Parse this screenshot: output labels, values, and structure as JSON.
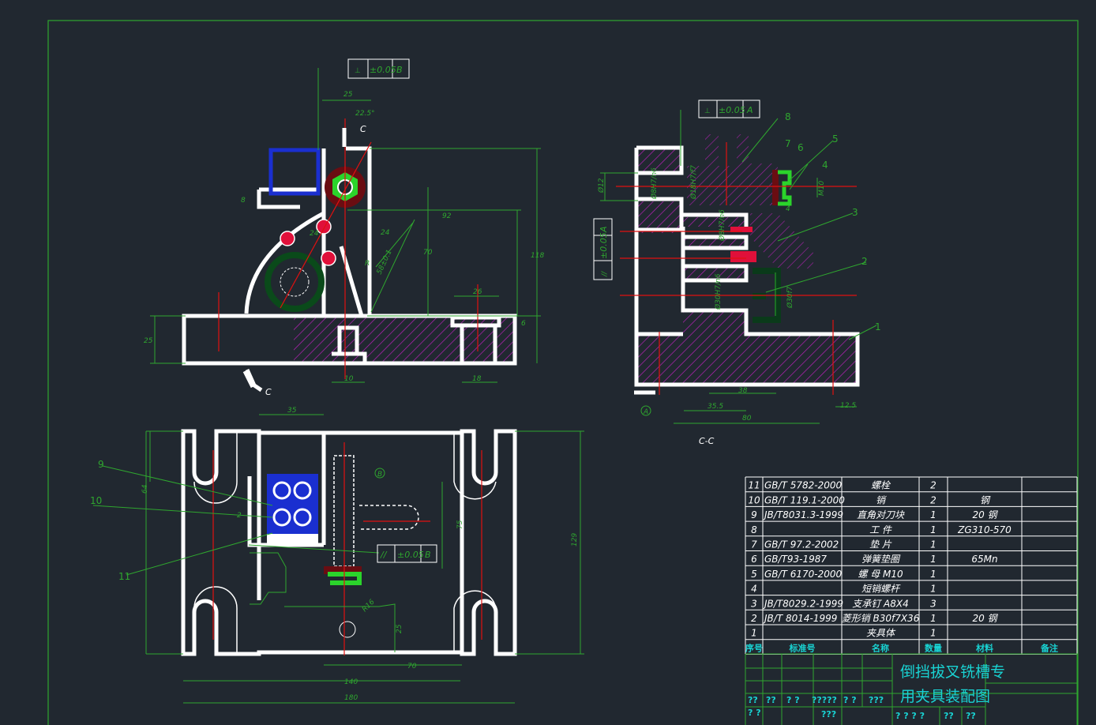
{
  "drawing": {
    "front_view": {
      "tolerance_frame": {
        "symbol": "⊥",
        "value": "±0.05",
        "datum": "B"
      },
      "section_marks": [
        "C",
        "C"
      ],
      "dimensions": [
        "25",
        "22.5°",
        "8",
        "92",
        "70",
        "118",
        "24",
        "24",
        "R",
        "58±0.1",
        "26",
        "6",
        "25",
        "10",
        "18",
        "6",
        "10"
      ]
    },
    "section_view": {
      "title": "C-C",
      "tolerance_top": {
        "symbol": "⊥",
        "value": "±0.05",
        "datum": "A"
      },
      "tolerance_left": {
        "symbol": "//",
        "value": "±0.05",
        "datum": "A"
      },
      "datum_label": "A",
      "part_callouts": [
        "8",
        "7",
        "6",
        "5",
        "4",
        "3",
        "2",
        "1"
      ],
      "dimensions": [
        "Ø12",
        "Ø8H7/n6",
        "Ø18H7/f7",
        "M10",
        "Ø8H7/n6",
        "Ø30H7/n6",
        "Ø30f7",
        "38",
        "35.5",
        "80",
        "12.5",
        "4"
      ]
    },
    "top_view": {
      "tolerance_frame": {
        "symbol": "//",
        "value": "±0.05",
        "datum": "B"
      },
      "datum_label": "B",
      "part_callouts": [
        "9",
        "10",
        "11"
      ],
      "dimensions": [
        "35",
        "64",
        "75",
        "129",
        "140",
        "180",
        "70",
        "25",
        "2",
        "R16"
      ]
    }
  },
  "parts_list": {
    "headers": [
      "序号",
      "标准号",
      "名称",
      "数量",
      "材料",
      "备注"
    ],
    "rows": [
      {
        "no": "11",
        "standard": "GB/T 5782-2000",
        "name": "螺栓",
        "qty": "2",
        "material": "",
        "note": ""
      },
      {
        "no": "10",
        "standard": "GB/T 119.1-2000",
        "name": "销",
        "qty": "2",
        "material": "钢",
        "note": ""
      },
      {
        "no": "9",
        "standard": "JB/T8031.3-1999",
        "name": "直角对刀块",
        "qty": "1",
        "material": "20 钢",
        "note": ""
      },
      {
        "no": "8",
        "standard": "",
        "name": "工 件",
        "qty": "1",
        "material": "ZG310-570",
        "note": ""
      },
      {
        "no": "7",
        "standard": "GB/T 97.2-2002",
        "name": "垫 片",
        "qty": "1",
        "material": "",
        "note": ""
      },
      {
        "no": "6",
        "standard": "GB/T93-1987",
        "name": "弹簧垫圈",
        "qty": "1",
        "material": "65Mn",
        "note": ""
      },
      {
        "no": "5",
        "standard": "GB/T 6170-2000",
        "name": "螺 母 M10",
        "qty": "1",
        "material": "",
        "note": ""
      },
      {
        "no": "4",
        "standard": "",
        "name": "短销螺杆",
        "qty": "1",
        "material": "",
        "note": ""
      },
      {
        "no": "3",
        "standard": "JB/T8029.2-1999",
        "name": "支承钉 A8X4",
        "qty": "3",
        "material": "",
        "note": ""
      },
      {
        "no": "2",
        "standard": "JB/T 8014-1999",
        "name": "菱形销 B30f7X36",
        "qty": "1",
        "material": "20 钢",
        "note": ""
      },
      {
        "no": "1",
        "standard": "",
        "name": "夹具体",
        "qty": "1",
        "material": "",
        "note": ""
      }
    ]
  },
  "title_block": {
    "title_line1": "倒挡拔叉铣槽专",
    "title_line2": "用夹具装配图",
    "row_a": [
      "??",
      "??",
      "? ?",
      "?????",
      "? ?",
      "???"
    ],
    "row_b": [
      "? ?",
      "???"
    ],
    "row_c": [
      "? ? ? ?",
      "??",
      "??"
    ]
  },
  "colors": {
    "background": "#212830",
    "frame": "#2fa62f",
    "outline": "#ffffff",
    "centerline": "#e01010",
    "hatch": "#c020c0",
    "title_text": "#19d3d3"
  }
}
